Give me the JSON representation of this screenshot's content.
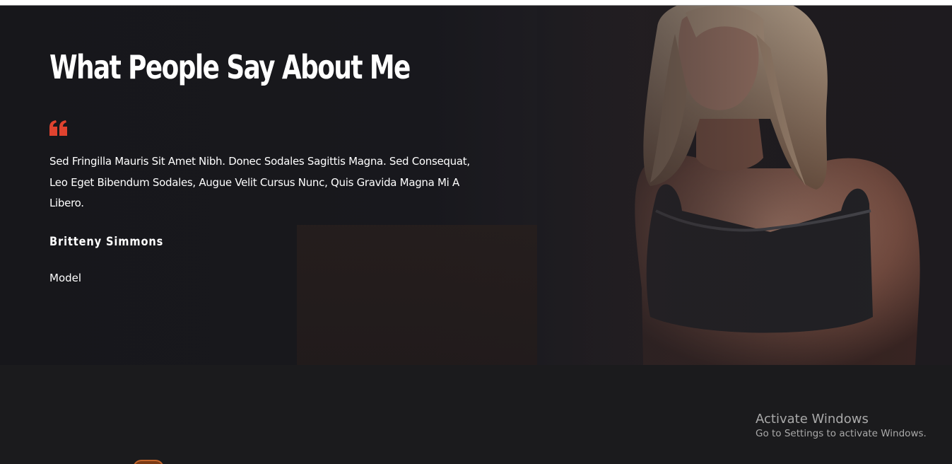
{
  "testimonial": {
    "title": "What People Say About Me",
    "quote": "Sed Fringilla Mauris Sit Amet Nibh. Donec Sodales Sagittis Magna. Sed Consequat, Leo Eget Bibendum Sodales, Augue Velit Cursus Nunc, Quis Gravida Magna Mi A Libero.",
    "author_name": "Britteny Simmons",
    "author_role": "Model",
    "quote_icon": "quote-left-icon",
    "photo_icon": "fitness-model-photo"
  },
  "watermark": {
    "title": "Activate Windows",
    "subtitle": "Go to Settings to activate Windows."
  },
  "colors": {
    "accent": "#e0432f",
    "background": "#1b1b1d",
    "text": "#ffffff"
  }
}
